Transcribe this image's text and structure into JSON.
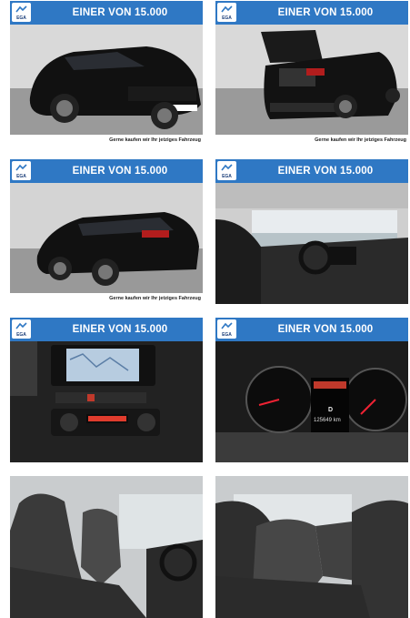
{
  "banner": {
    "text": "EINER VON 15.000",
    "logo_text": "EGA"
  },
  "footer": {
    "text": "Gerne kaufen wir Ihr jetziges Fahrzeug"
  },
  "tiles": [
    {
      "caption": "front-left exterior"
    },
    {
      "caption": "rear open trunk"
    },
    {
      "caption": "rear-left exterior"
    },
    {
      "caption": "interior dashboard"
    },
    {
      "caption": "center console"
    },
    {
      "caption": "instrument cluster"
    },
    {
      "caption": "front seats"
    },
    {
      "caption": "rear seats"
    }
  ],
  "cluster": {
    "odometer": "125649 km",
    "gear": "D"
  }
}
